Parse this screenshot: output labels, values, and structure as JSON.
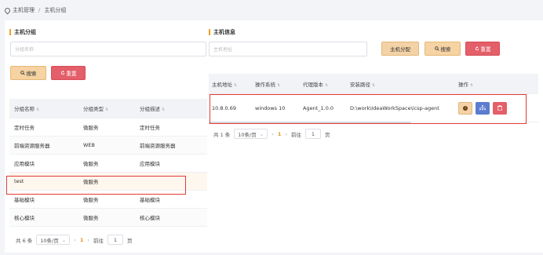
{
  "breadcrumb": {
    "root": "主机管理",
    "separator": "/",
    "current": "主机分组"
  },
  "left": {
    "title": "主机分组",
    "filter_placeholder": "分组名称",
    "search_label": "搜索",
    "reset_label": "重置",
    "columns": [
      "分组名称",
      "分组类型",
      "分组描述"
    ],
    "rows": [
      [
        "定时任务",
        "微服务",
        "定时任务"
      ],
      [
        "前端资源服务器",
        "WEB",
        "前端资源服务器"
      ],
      [
        "应用模块",
        "微服务",
        "应用模块"
      ],
      [
        "test",
        "微服务",
        ""
      ],
      [
        "基础模块",
        "微服务",
        "基础模块"
      ],
      [
        "核心模块",
        "微服务",
        "核心模块"
      ]
    ],
    "pager": {
      "total": "共 6 条",
      "page_size": "10条/页",
      "current": "1",
      "goto": "前往",
      "goto_value": "1",
      "unit": "页"
    }
  },
  "right": {
    "title": "主机信息",
    "filter_placeholder": "主机地址",
    "assign_label": "主机分配",
    "search_label": "搜索",
    "reset_label": "重置",
    "columns": [
      "主机地址",
      "操作系统",
      "代理版本",
      "安装路径",
      "操作"
    ],
    "rows": [
      [
        "10.8.0.69",
        "windows 10",
        "Agent_1.0.0",
        "D:\\work\\IdeaWorkSpace\\icsp-agent"
      ]
    ],
    "pager": {
      "total": "共 1 条",
      "page_size": "10条/页",
      "current": "1",
      "goto": "前往",
      "goto_value": "1",
      "unit": "页"
    }
  },
  "colors": {
    "accent": "#f0a020",
    "danger": "#e35f69",
    "primary": "#5b7ccf",
    "highlight": "#e53935"
  },
  "icons": {
    "search": "search-icon",
    "reset": "refresh-icon",
    "info": "info-icon",
    "tree": "sitemap-icon",
    "delete": "trash-icon",
    "location": "location-pin-icon"
  }
}
